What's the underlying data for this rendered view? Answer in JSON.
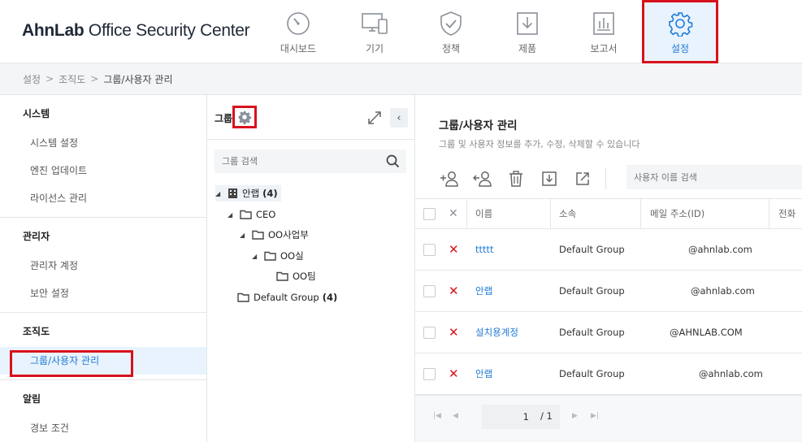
{
  "app": {
    "logo_bold": "AhnLab",
    "logo_rest": "Office Security Center"
  },
  "nav": [
    {
      "label": "대시보드",
      "icon": "dashboard-gauge-icon"
    },
    {
      "label": "기기",
      "icon": "device-monitor-icon"
    },
    {
      "label": "정책",
      "icon": "policy-shield-icon"
    },
    {
      "label": "제품",
      "icon": "product-download-icon"
    },
    {
      "label": "보고서",
      "icon": "report-chart-icon"
    },
    {
      "label": "설정",
      "icon": "settings-gear-icon",
      "active": true
    }
  ],
  "breadcrumb": [
    "설정",
    "조직도",
    "그룹/사용자 관리"
  ],
  "sidebar": {
    "sections": [
      {
        "title": "시스템",
        "items": [
          "시스템 설정",
          "엔진 업데이트",
          "라이선스 관리"
        ]
      },
      {
        "title": "관리자",
        "items": [
          "관리자 계정",
          "보안 설정"
        ]
      },
      {
        "title": "조직도",
        "items": [
          "그룹/사용자 관리"
        ]
      },
      {
        "title": "알림",
        "items": [
          "경보 조건"
        ]
      }
    ],
    "active_item": "그룹/사용자 관리"
  },
  "tree": {
    "title": "그룹",
    "search_placeholder": "그룹 검색",
    "nodes": [
      {
        "label": "안랩",
        "count": "(4)",
        "type": "company"
      },
      {
        "label": "CEO",
        "type": "folder"
      },
      {
        "label": "OO사업부",
        "type": "folder"
      },
      {
        "label": "OO실",
        "type": "folder"
      },
      {
        "label": "OO팀",
        "type": "folder"
      },
      {
        "label": "Default Group",
        "count": "(4)",
        "type": "folder"
      }
    ]
  },
  "main": {
    "title": "그룹/사용자 관리",
    "subtitle": "그룹 및 사용자 정보를 추가, 수정, 삭제할 수 있습니다",
    "user_search_placeholder": "사용자 이름 검색",
    "columns": [
      "이름",
      "소속",
      "메일 주소(ID)",
      "전화"
    ],
    "rows": [
      {
        "name": "ttttt",
        "group": "Default Group",
        "email": "@ahnlab.com"
      },
      {
        "name": "안랩",
        "group": "Default Group",
        "email": "@ahnlab.com"
      },
      {
        "name": "설치용계정",
        "group": "Default Group",
        "email": "@AHNLAB.COM"
      },
      {
        "name": "안랩",
        "group": "Default Group",
        "email": "@ahnlab.com"
      }
    ],
    "pager": {
      "current": "1",
      "total": "/ 1"
    }
  },
  "colors": {
    "accent": "#1f7ad6",
    "highlight": "#d8121c",
    "active_bg": "#e8f3fd"
  }
}
